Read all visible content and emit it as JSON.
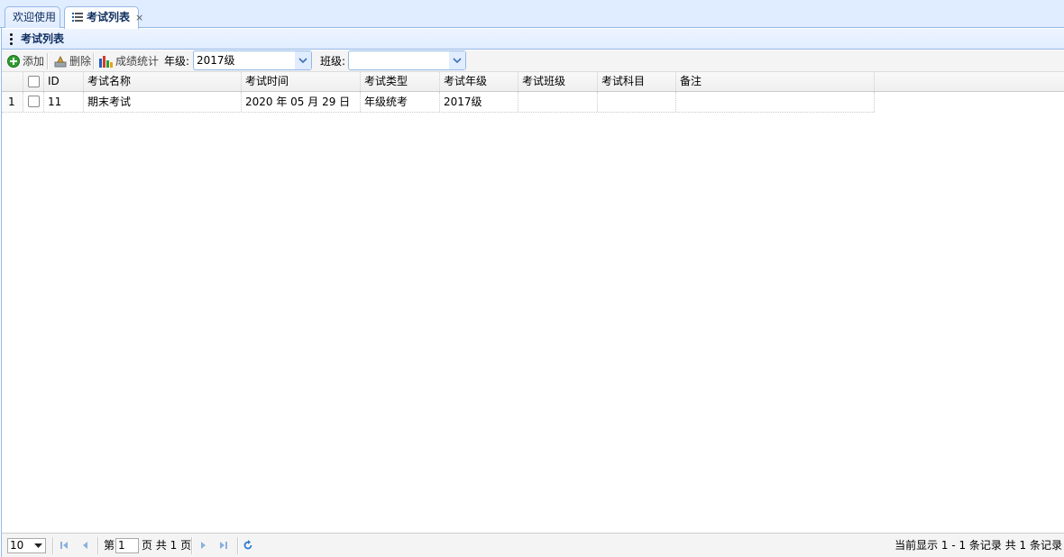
{
  "tabs": [
    {
      "label": "欢迎使用"
    },
    {
      "label": "考试列表",
      "close": "×"
    }
  ],
  "panel": {
    "title": "考试列表"
  },
  "toolbar": {
    "add_label": "添加",
    "delete_label": "删除",
    "stats_label": "成绩统计",
    "grade_label": "年级:",
    "grade_value": "2017级",
    "class_label": "班级:",
    "class_value": ""
  },
  "grid": {
    "columns": [
      "ID",
      "考试名称",
      "考试时间",
      "考试类型",
      "考试年级",
      "考试班级",
      "考试科目",
      "备注"
    ],
    "rows": [
      {
        "num": "1",
        "id": "11",
        "name": "期末考试",
        "time": "2020 年 05 月 29 日",
        "type": "年级统考",
        "grade": "2017级",
        "class": "",
        "subject": "",
        "remark": ""
      }
    ]
  },
  "pager": {
    "page_size": "10",
    "page_prefix": "第",
    "page_value": "1",
    "page_suffix": "页 共 1 页",
    "info": "当前显示 1 - 1 条记录 共 1 条记录"
  },
  "colors": {
    "header_bg": "#e0ecff",
    "border": "#95b8e7",
    "title_text": "#0e2d5f"
  }
}
